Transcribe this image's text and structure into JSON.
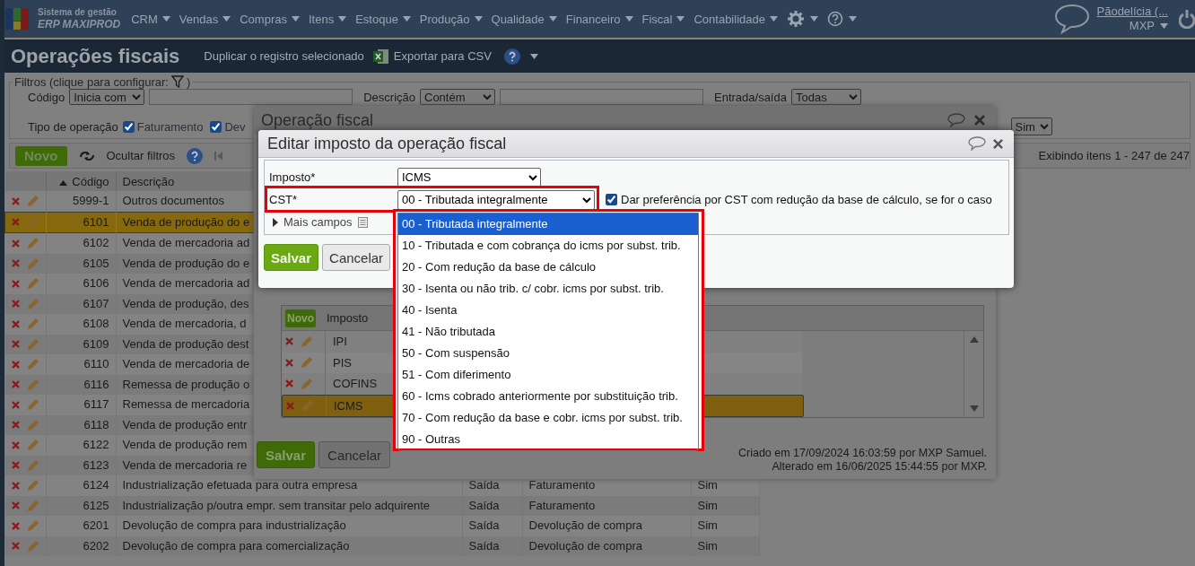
{
  "nav": {
    "logo_top": "Sistema de gestão",
    "logo_bottom": "ERP MAXIPROD",
    "menus": [
      "CRM",
      "Vendas",
      "Compras",
      "Itens",
      "Estoque",
      "Produção",
      "Qualidade",
      "Financeiro",
      "Fiscal",
      "Contabilidade"
    ],
    "user": "Pãodelícia (...",
    "company": "MXP"
  },
  "page": {
    "title": "Operações fiscais",
    "duplicate": "Duplicar o registro selecionado",
    "export": "Exportar para CSV"
  },
  "filters": {
    "legend": "Filtros (clique para configurar:",
    "legend_end": ")",
    "code_label": "Código",
    "code_mode": "Inicia com",
    "description_label": "Descrição",
    "description_mode": "Contém",
    "direction_label": "Entrada/saída",
    "direction_value": "Todas",
    "type_label": "Tipo de operação",
    "types": [
      {
        "label": "Faturamento",
        "checked": true
      },
      {
        "label": "Dev",
        "checked": true
      }
    ],
    "last_value": "Sim"
  },
  "toolbar": {
    "new": "Novo",
    "hide_filters": "Ocultar filtros",
    "range": "Exibindo itens 1 - 247 de 247"
  },
  "table": {
    "columns": [
      "Código",
      "Descrição"
    ],
    "rows": [
      {
        "code": "5999-1",
        "description": "Outros documentos",
        "selected": false
      },
      {
        "code": "6101",
        "description": "Venda de produção do e",
        "selected": true
      },
      {
        "code": "6102",
        "description": "Venda de mercadoria ad",
        "selected": false
      },
      {
        "code": "6105",
        "description": "Venda de produção do e",
        "selected": false
      },
      {
        "code": "6106",
        "description": "Venda de mercadoria ad",
        "selected": false
      },
      {
        "code": "6107",
        "description": "Venda de produção, des",
        "selected": false
      },
      {
        "code": "6108",
        "description": "Venda de mercadoria, d",
        "selected": false
      },
      {
        "code": "6109",
        "description": "Venda de produção dest",
        "selected": false
      },
      {
        "code": "6110",
        "description": "Venda de mercadoria de",
        "selected": false
      },
      {
        "code": "6116",
        "description": "Remessa de produção o",
        "selected": false
      },
      {
        "code": "6117",
        "description": "Remessa de mercadoria",
        "selected": false
      },
      {
        "code": "6118",
        "description": "Venda de produção entr",
        "selected": false
      },
      {
        "code": "6122",
        "description": "Venda de produção rem",
        "selected": false
      },
      {
        "code": "6123",
        "description": "Venda de mercadoria re",
        "selected": false
      },
      {
        "code": "6124",
        "description": "Industrialização efetuada para outra empresa",
        "direction": "Saída",
        "type": "Faturamento",
        "column_5": "Sim",
        "selected": false
      },
      {
        "code": "6125",
        "description": "Industrialização p/outra empr. sem transitar pelo adquirente",
        "direction": "Saída",
        "type": "Faturamento",
        "column_5": "Sim",
        "selected": false
      },
      {
        "code": "6201",
        "description": "Devolução de compra para industrialização",
        "direction": "Saída",
        "type": "Devolução de compra",
        "column_5": "Sim",
        "selected": false
      },
      {
        "code": "6202",
        "description": "Devolução de compra para comercialização",
        "direction": "Saída",
        "type": "Devolução de compra",
        "column_5": "Sim",
        "selected": false
      }
    ]
  },
  "operation_dialog": {
    "title": "Operação fiscal",
    "grid": {
      "new": "Novo",
      "column": "Imposto",
      "rows": [
        {
          "tax": "IPI",
          "selected": false
        },
        {
          "tax": "PIS",
          "selected": false
        },
        {
          "tax": "COFINS",
          "selected": false
        },
        {
          "tax": "ICMS",
          "selected": true
        }
      ]
    },
    "save": "Salvar",
    "cancel": "Cancelar",
    "created": "Criado em 17/09/2024 16:03:59 por MXP Samuel.",
    "changed": "Alterado em 16/06/2025 15:44:55 por MXP."
  },
  "tax_dialog": {
    "title": "Editar imposto da operação fiscal",
    "tax_label": "Imposto*",
    "tax_value": "ICMS",
    "cst_label": "CST*",
    "cst_value": "00 - Tributada integralmente",
    "prefer": {
      "label": "Dar preferência por CST com redução da base de cálculo, se for o caso",
      "checked": true
    },
    "more_fields": "Mais campos",
    "save": "Salvar",
    "cancel": "Cancelar"
  },
  "cst_options": [
    {
      "label": "00 - Tributada integralmente",
      "selected": true
    },
    {
      "label": "10 - Tributada e com cobrança do icms por subst. trib.",
      "selected": false
    },
    {
      "label": "20 - Com redução da base de cálculo",
      "selected": false
    },
    {
      "label": "30 - Isenta ou não trib. c/ cobr. icms por subst. trib.",
      "selected": false
    },
    {
      "label": "40 - Isenta",
      "selected": false
    },
    {
      "label": "41 - Não tributada",
      "selected": false
    },
    {
      "label": "50 - Com suspensão",
      "selected": false
    },
    {
      "label": "51 - Com diferimento",
      "selected": false
    },
    {
      "label": "60 - Icms cobrado anteriormente por substituição trib.",
      "selected": false
    },
    {
      "label": "70 - Com redução da base e cobr. icms por subst. trib.",
      "selected": false
    },
    {
      "label": "90 - Outras",
      "selected": false
    }
  ]
}
